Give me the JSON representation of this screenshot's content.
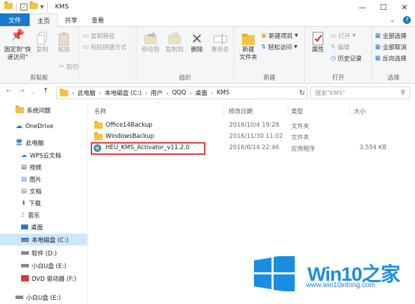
{
  "window": {
    "title": "KMS",
    "minimize": "—",
    "maximize": "☐",
    "close": "✕"
  },
  "tabs": {
    "file": "文件",
    "home": "主页",
    "share": "共享",
    "view": "查看"
  },
  "ribbon": {
    "clipboard": {
      "label": "剪贴板",
      "pin": "固定到\"快\n速访问\"",
      "copy": "复制",
      "paste": "粘贴",
      "copy_path": "复制路径",
      "paste_shortcut": "粘贴快捷方式",
      "cut": "剪切"
    },
    "organize": {
      "label": "组织",
      "move_to": "移动到",
      "copy_to": "复制到",
      "delete": "删除",
      "rename": "重命名"
    },
    "new": {
      "label": "新建",
      "new_folder": "新建\n文件夹",
      "new_item": "新建项目",
      "easy_access": "轻松访问"
    },
    "open": {
      "label": "打开",
      "properties": "属性",
      "open": "打开",
      "edit": "编辑",
      "history": "历史记录"
    },
    "select": {
      "label": "选择",
      "select_all": "全部选择",
      "select_none": "全部取消",
      "invert": "反向选择"
    }
  },
  "address": {
    "crumbs": [
      "此电脑",
      "本地磁盘 (C:)",
      "用户",
      "QQQ",
      "桌面",
      "KMS"
    ],
    "search_placeholder": "搜索\"KMS\""
  },
  "nav": {
    "items": [
      {
        "label": "系统问题",
        "icon": "folder-icon"
      },
      {
        "label": "OneDrive",
        "icon": "cloud-icon"
      },
      {
        "label": "此电脑",
        "icon": "computer-icon"
      },
      {
        "label": "WPS云文档",
        "icon": "cloud-doc-icon"
      },
      {
        "label": "视频",
        "icon": "video-icon"
      },
      {
        "label": "图片",
        "icon": "image-icon"
      },
      {
        "label": "文档",
        "icon": "document-icon"
      },
      {
        "label": "下载",
        "icon": "download-icon"
      },
      {
        "label": "音乐",
        "icon": "music-icon"
      },
      {
        "label": "桌面",
        "icon": "desktop-icon"
      },
      {
        "label": "本地磁盘 (C:)",
        "icon": "drive-icon"
      },
      {
        "label": "软件 (D:)",
        "icon": "drive-icon"
      },
      {
        "label": "小白U盘 (E:)",
        "icon": "usb-icon"
      },
      {
        "label": "DVD 驱动器 (F:)",
        "icon": "dvd-icon"
      },
      {
        "label": "小白U盘 (E:)",
        "icon": "usb-icon"
      }
    ]
  },
  "files": {
    "headers": {
      "name": "名称",
      "modified": "修改日期",
      "type": "类型",
      "size": "大小"
    },
    "rows": [
      {
        "name": "Office14Backup",
        "modified": "2016/10/4 19:28",
        "type": "文件夹",
        "size": ""
      },
      {
        "name": "WindowsBackup",
        "modified": "2016/11/30 11:02",
        "type": "文件夹",
        "size": ""
      },
      {
        "name": "HEU_KMS_Activator_v11.2.0",
        "modified": "2016/6/14 22:46",
        "type": "应用程序",
        "size": "3,554 KB"
      }
    ]
  },
  "watermark": {
    "brand": "Win10",
    "brand_cn": "之家",
    "site": "www.win10xitong.com"
  },
  "colors": {
    "accent": "#1979ca",
    "highlight": "#e03a3a",
    "selection": "#cce8ff",
    "folder": "#f5c342"
  }
}
